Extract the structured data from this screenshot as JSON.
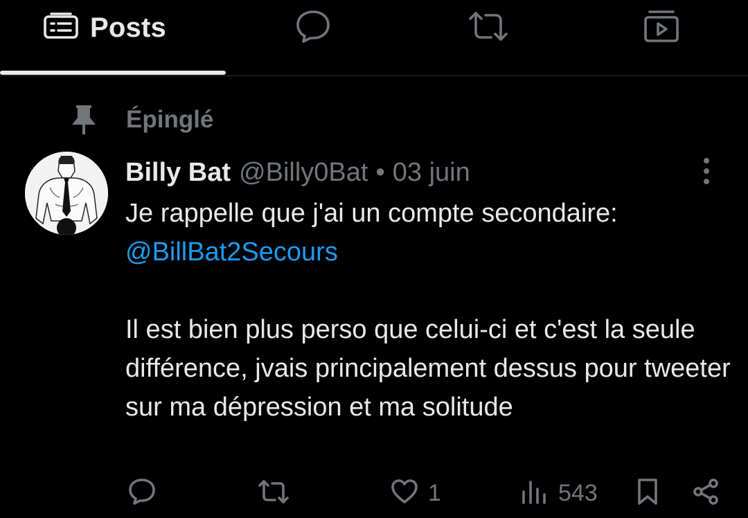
{
  "tabs": {
    "posts_label": "Posts",
    "replies_icon": "speech-bubble-icon",
    "reposts_icon": "repost-icon",
    "media_icon": "media-play-icon"
  },
  "pinned": {
    "label": "Épinglé",
    "icon": "pin-icon"
  },
  "post": {
    "author_name": "Billy Bat",
    "author_handle": "@Billy0Bat",
    "separator": "•",
    "date": "03 juin",
    "text_line1": "Je rappelle que j'ai un compte secondaire:",
    "mention": "@BillBat2Secours",
    "text_paragraph2": "Il est bien plus perso que celui-ci et c'est la seule différence, jvais principalement dessus pour tweeter sur ma dépression et ma solitude",
    "actions": {
      "reply_icon": "reply-icon",
      "repost_icon": "repost-icon",
      "like_icon": "heart-icon",
      "like_count": "1",
      "views_icon": "views-bar-icon",
      "views_count": "543",
      "bookmark_icon": "bookmark-icon",
      "share_icon": "share-icon"
    }
  },
  "colors": {
    "background": "#000000",
    "text_primary": "#e7e9ea",
    "text_secondary": "#71767b",
    "link": "#1d9bf0",
    "divider": "#2a2d30"
  }
}
